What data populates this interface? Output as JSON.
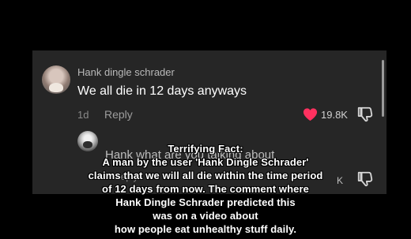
{
  "panel": {
    "comment": {
      "username": "Hank dingle schrader",
      "text": "We all die in 12 days anyways",
      "age": "1d",
      "reply_label": "Reply",
      "like_count": "19.8K",
      "icons": {
        "like": "heart-icon",
        "dislike": "thumb-down-icon"
      }
    },
    "reply": {
      "username": "Hank what are you talking about",
      "reply_label": "Reply",
      "like_count": "K",
      "icons": {
        "dislike": "thumb-down-icon"
      }
    }
  },
  "caption": {
    "lines": [
      "Terrifying Fact:",
      "A man by the user 'Hank Dingle Schrader'",
      "claims that we will all die within the time period",
      "of 12 days from now. The comment where",
      "Hank Dingle Schrader predicted this",
      "was on a video about",
      "how people eat unhealthy stuff daily."
    ]
  },
  "colors": {
    "background": "#000000",
    "panel": "#262626",
    "accent_heart": "#ff315f",
    "text_primary": "#ffffff",
    "text_secondary": "#b9b9b9"
  }
}
